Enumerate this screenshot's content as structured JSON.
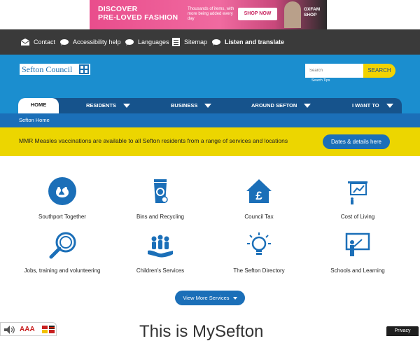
{
  "ad": {
    "headline_line1": "DISCOVER",
    "headline_line2": "PRE-LOVED FASHION",
    "subtext": "Thousands of items, with more being added every day",
    "button": "SHOP NOW",
    "logo_line1": "OXFAM",
    "logo_line2": "SHOP"
  },
  "utility": {
    "contact": "Contact",
    "accessibility": "Accessibility help",
    "languages": "Languages",
    "sitemap": "Sitemap",
    "listen": "Listen and translate"
  },
  "header": {
    "logo_text": "Sefton Council",
    "search_placeholder": "Search",
    "search_button": "SEARCH",
    "search_tips": "Search Tips"
  },
  "nav": {
    "home": "HOME",
    "residents": "RESIDENTS",
    "business": "BUSINESS",
    "around": "AROUND SEFTON",
    "iwant": "I WANT TO"
  },
  "breadcrumb": "Sefton Home",
  "alert": {
    "text": "MMR Measles vaccinations are available to all Sefton residents from a range of services and locations",
    "button": "Dates & details here"
  },
  "services": [
    {
      "label": "Southport Together",
      "icon": "southport-together-icon"
    },
    {
      "label": "Bins and Recycling",
      "icon": "recycling-bin-icon"
    },
    {
      "label": "Council Tax",
      "icon": "house-pound-icon"
    },
    {
      "label": "Cost of Living",
      "icon": "presentation-chart-icon"
    },
    {
      "label": "Jobs, training and volunteering",
      "icon": "magnifier-icon"
    },
    {
      "label": "Children's Services",
      "icon": "family-hands-icon"
    },
    {
      "label": "The Sefton Directory",
      "icon": "lightbulb-icon"
    },
    {
      "label": "Schools and Learning",
      "icon": "teacher-board-icon"
    }
  ],
  "more_button": "View More Services",
  "page_heading": "This is MySefton",
  "access_widget": {
    "text": "AAA"
  },
  "privacy": "Privacy",
  "colors": {
    "primary": "#1b8ecf",
    "navy": "#16538c",
    "alert": "#ecd600",
    "button": "#1b6fb8",
    "topbar": "#3a3a3a"
  }
}
